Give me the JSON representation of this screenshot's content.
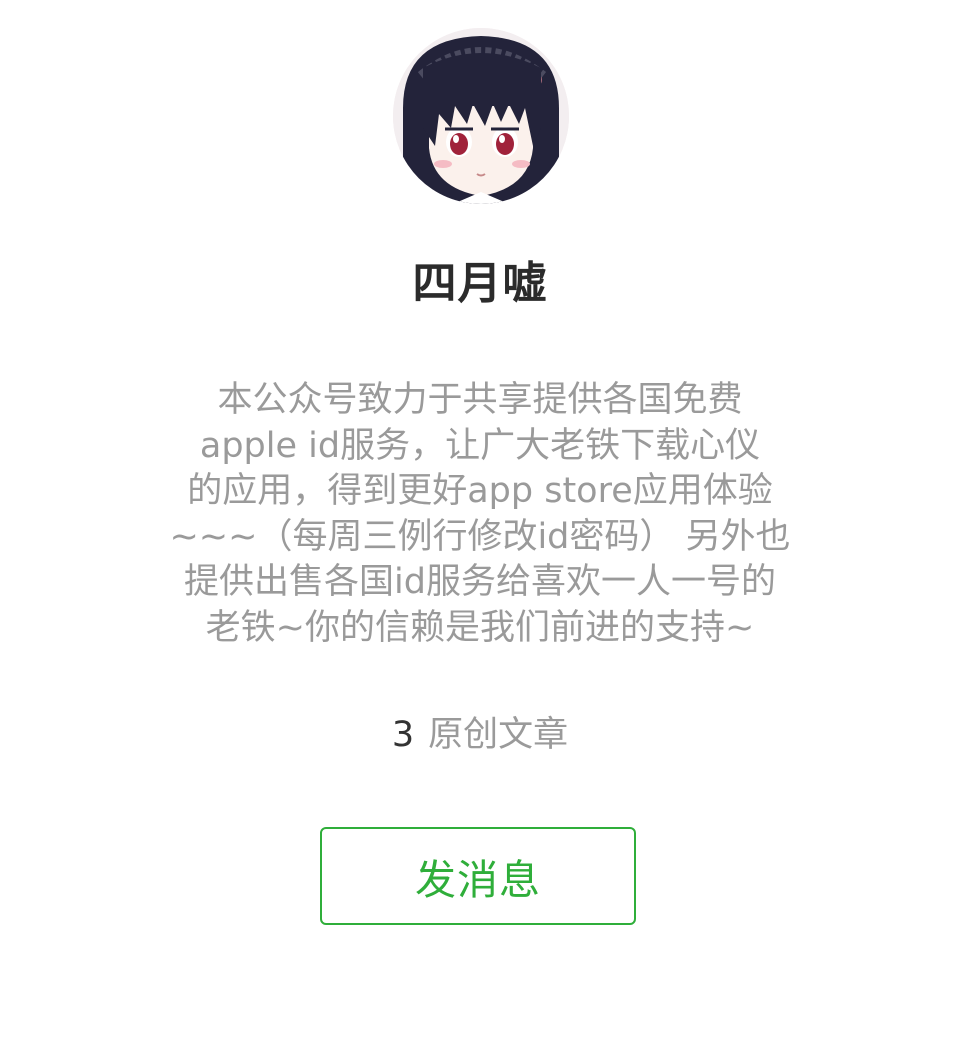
{
  "profile": {
    "avatar_icon": "anime-girl-avatar",
    "name": "四月嘘",
    "description_lines": [
      "本公众号致力于共享提供各国免费",
      "apple id服务，让广大老铁下载心仪",
      "的应用，得到更好app store应用体验",
      "~~~（每周三例行修改id密码） 另外也",
      "提供出售各国id服务给喜欢一人一号的",
      "老铁~你的信赖是我们前进的支持~"
    ],
    "stats": {
      "count": "3",
      "label": "原创文章"
    },
    "message_button_label": "发消息"
  },
  "colors": {
    "accent": "#2fae3a",
    "name_text": "#2b2b2b",
    "muted_text": "#9a9a9a"
  }
}
